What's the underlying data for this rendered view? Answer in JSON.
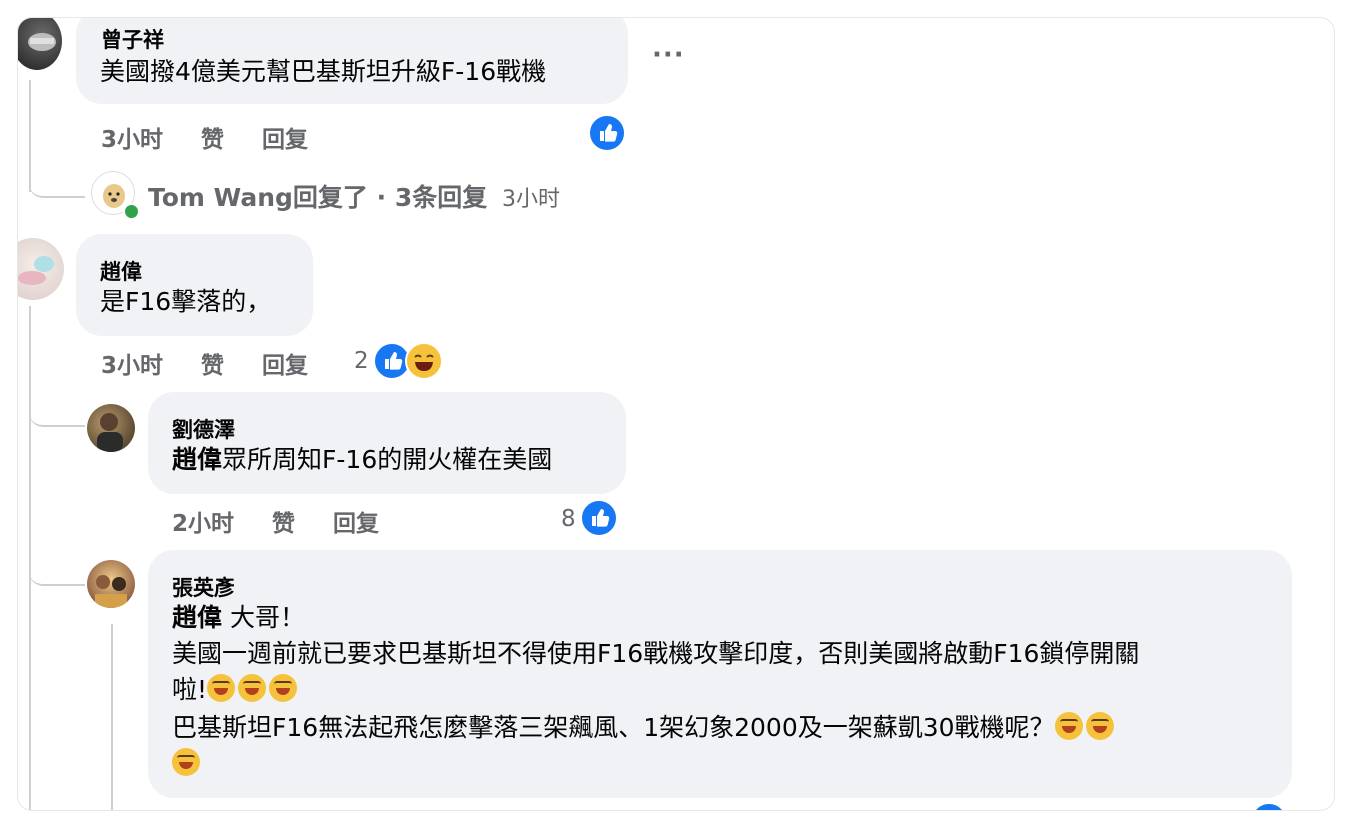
{
  "comments": [
    {
      "author": "曾子祥",
      "text": "美國撥4億美元幫巴基斯坦升級F-16戰機",
      "time": "3小时",
      "like": "赞",
      "reply": "回复",
      "more": "···",
      "replies_summary": {
        "author": "Tom Wang",
        "text": "回复了 · 3条回复",
        "time": "3小时"
      }
    },
    {
      "author": "趙偉",
      "text": "是F16擊落的，",
      "time": "3小时",
      "like": "赞",
      "reply": "回复",
      "reaction_count": "2",
      "replies": [
        {
          "author": "劉德澤",
          "mention": "趙偉",
          "text": "眾所周知F-16的開火權在美國",
          "time": "2小时",
          "like": "赞",
          "reply": "回复",
          "reaction_count": "8"
        },
        {
          "author": "張英彥",
          "mention": "趙偉",
          "line1_rest": " 大哥！",
          "line2": "美國一週前就已要求巴基斯坦不得使用F16戰機攻擊印度，否則美國將啟動F16鎖停開關",
          "line3": "啦!",
          "line4": "巴基斯坦F16無法起飛怎麼擊落三架飆風、1架幻象2000及一架蘇凱30戰機呢？"
        }
      ]
    }
  ],
  "colors": {
    "bubble": "#f0f2f5",
    "meta": "#65676b",
    "like_blue": "#1877f2",
    "online_green": "#31a24c"
  }
}
